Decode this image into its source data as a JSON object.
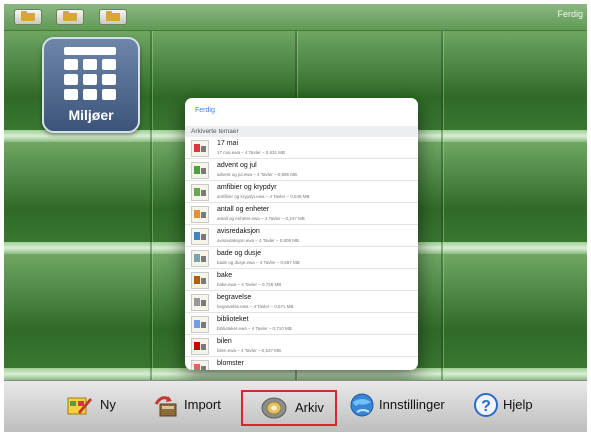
{
  "topbar": {
    "done_label": "Ferdig",
    "buttons": [
      "folder-icon",
      "folder-grid-icon",
      "folder-icon"
    ]
  },
  "environment": {
    "label": "Miljøer"
  },
  "popover": {
    "done_label": "Ferdig",
    "section_title": "Arkiverte temaer",
    "items": [
      {
        "title": "17 mai",
        "sub": "17 mai.ewa – 4 Tavler – 0,631 MB",
        "icon": "flag-icon"
      },
      {
        "title": "advent og jul",
        "sub": "advent og jul.ewa – 4 Tavler – 0,695 MB",
        "icon": "christmas-icon"
      },
      {
        "title": "amfibier og krypdyr",
        "sub": "amfibier og krypdyr.ewa – 4 Tavler – 0,549 MB",
        "icon": "frog-icon"
      },
      {
        "title": "antall og enheter",
        "sub": "antall og enheter.ewa – 4 Tavler – 0,247 MB",
        "icon": "counting-icon"
      },
      {
        "title": "avisredaksjon",
        "sub": "avisredaksjon.ewa – 4 Tavler – 0,808 MB",
        "icon": "newspaper-icon"
      },
      {
        "title": "bade og dusje",
        "sub": "bade og dusje.ewa – 4 Tavler – 0,687 MB",
        "icon": "bath-icon"
      },
      {
        "title": "bake",
        "sub": "bake.ewa – 4 Tavler – 0,728 MB",
        "icon": "baking-icon"
      },
      {
        "title": "begravelse",
        "sub": "begravelse.ewa – 4 Tavler – 0,571 MB",
        "icon": "grave-icon"
      },
      {
        "title": "biblioteket",
        "sub": "biblioteket.ewa – 4 Tavler – 0,710 MB",
        "icon": "library-icon"
      },
      {
        "title": "bilen",
        "sub": "bilen.ewa – 4 Tavler – 0,537 MB",
        "icon": "car-icon"
      },
      {
        "title": "blomster",
        "sub": "blomster.ewa – 4 Tavler – 0,647 MB",
        "icon": "flower-icon"
      }
    ]
  },
  "toolbar": {
    "new_label": "Ny",
    "import_label": "Import",
    "archive_label": "Arkiv",
    "settings_label": "Innstillinger",
    "help_label": "Hjelp"
  },
  "colors": {
    "highlight": "#d8262e",
    "link": "#3b82f6",
    "shelf": "#3f7d36"
  }
}
